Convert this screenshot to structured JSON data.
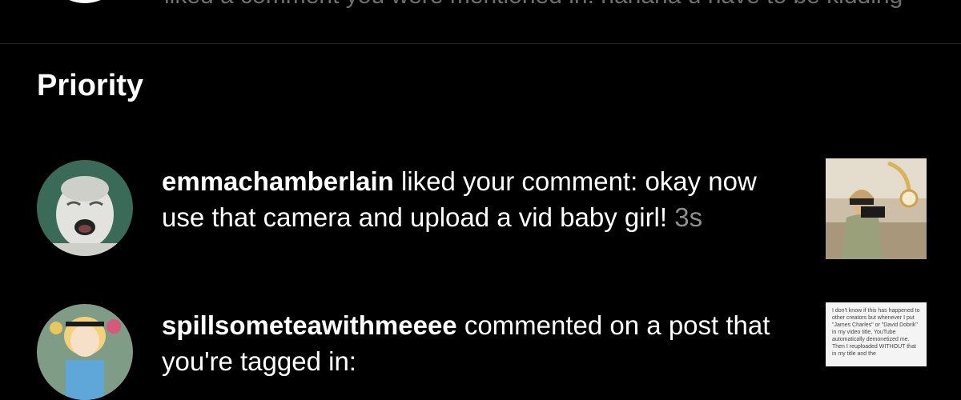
{
  "top_notification": {
    "text": "liked a comment you were mentioned in: hahaha u have to be kidding"
  },
  "section": {
    "title": "Priority"
  },
  "notifications": [
    {
      "username": "emmachamberlain",
      "action": " liked your comment: ",
      "content": "okay now use that camera and upload a vid baby girl!",
      "timestamp": "3s"
    },
    {
      "username": "spillsometeawithmeeee",
      "action": " commented on a ",
      "content": "post that you're tagged in:"
    }
  ],
  "doc_thumb_text": "I don't know if this has happened to other creators but whenever I put \"James Charles\" or \"David Dobrik\" in my video title, YouTube automatically demonetized me. Then I reuploaded WITHOUT that in my title and the"
}
